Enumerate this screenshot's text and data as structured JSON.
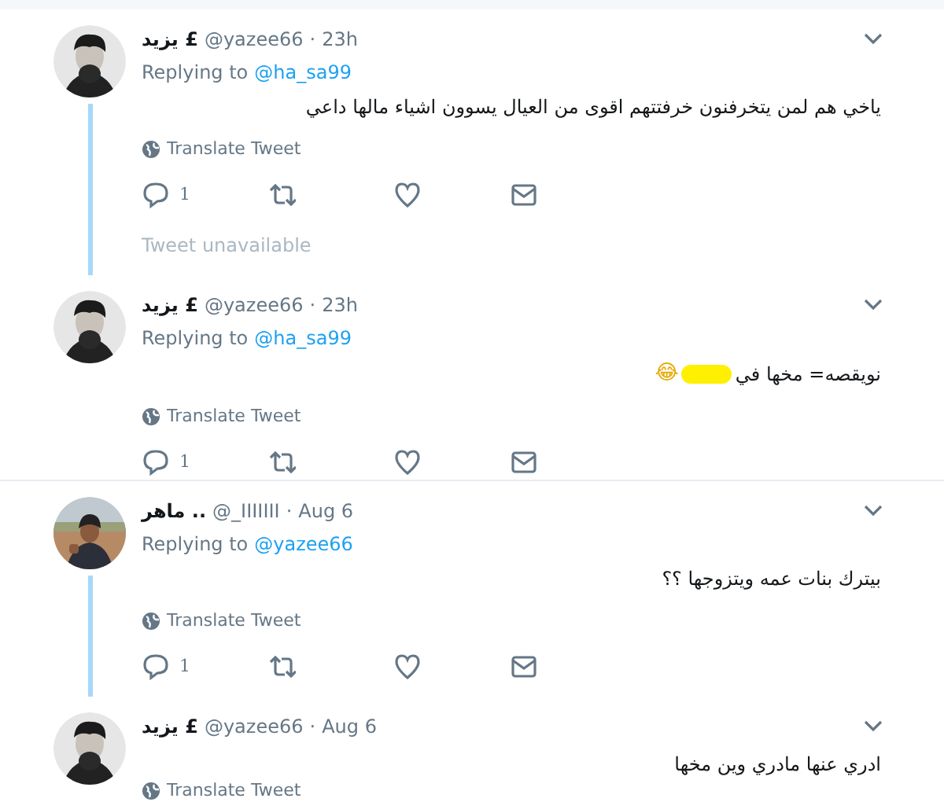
{
  "items": [
    {
      "kind": "tweet",
      "name": "يزيد £",
      "handle": "@yazee66",
      "dot": "·",
      "time": "23h",
      "replying_label": "Replying to",
      "replying_to": "@ha_sa99",
      "text": "ياخي هم لمن يتخرفنون خرفتتهم اقوى من العيال يسوون اشياء مالها داعي",
      "translate": "Translate Tweet",
      "replies": "1",
      "thread_line": true,
      "separator": false
    },
    {
      "kind": "unavailable",
      "text": "Tweet unavailable",
      "thread_line": true,
      "separator": false
    },
    {
      "kind": "tweet",
      "name": "يزيد £",
      "handle": "@yazee66",
      "dot": "·",
      "time": "23h",
      "replying_label": "Replying to",
      "replying_to": "@ha_sa99",
      "text": "نويقصه= مخها في",
      "redacted": true,
      "emoji": "😂",
      "translate": "Translate Tweet",
      "replies": "1",
      "thread_line": false,
      "separator": true
    },
    {
      "kind": "tweet",
      "name": "ماهر ..",
      "handle": "@_IIIIIII",
      "dot": "·",
      "time": "Aug 6",
      "replying_label": "Replying to",
      "replying_to": "@yazee66",
      "text": "بيترك بنات عمه ويتزوجها ؟؟",
      "translate": "Translate Tweet",
      "replies": "1",
      "thread_line": true,
      "separator": false
    },
    {
      "kind": "tweet",
      "name": "يزيد £",
      "handle": "@yazee66",
      "dot": "·",
      "time": "Aug 6",
      "text": "ادري عنها مادري وين مخها",
      "translate": "Translate Tweet",
      "thread_line": false,
      "separator": false
    }
  ]
}
